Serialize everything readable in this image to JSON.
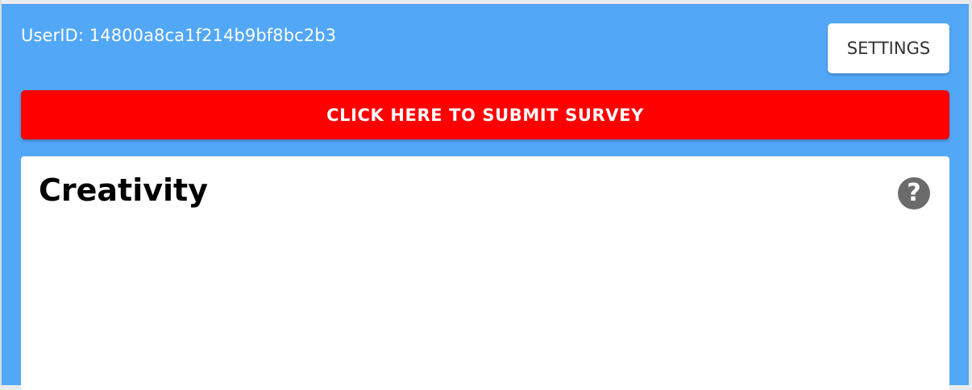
{
  "header": {
    "user_id_text": "UserID: 14800a8ca1f214b9bf8bc2b3",
    "settings_label": "SETTINGS"
  },
  "submit": {
    "label": "CLICK HERE TO SUBMIT SURVEY"
  },
  "card": {
    "title": "Creativity",
    "help_glyph": "?",
    "help_icon": "question-circle-icon"
  },
  "colors": {
    "panel_background": "#52a7f7",
    "submit_button": "#ff0000",
    "card_background": "#ffffff",
    "help_icon": "#6b6b6b"
  }
}
